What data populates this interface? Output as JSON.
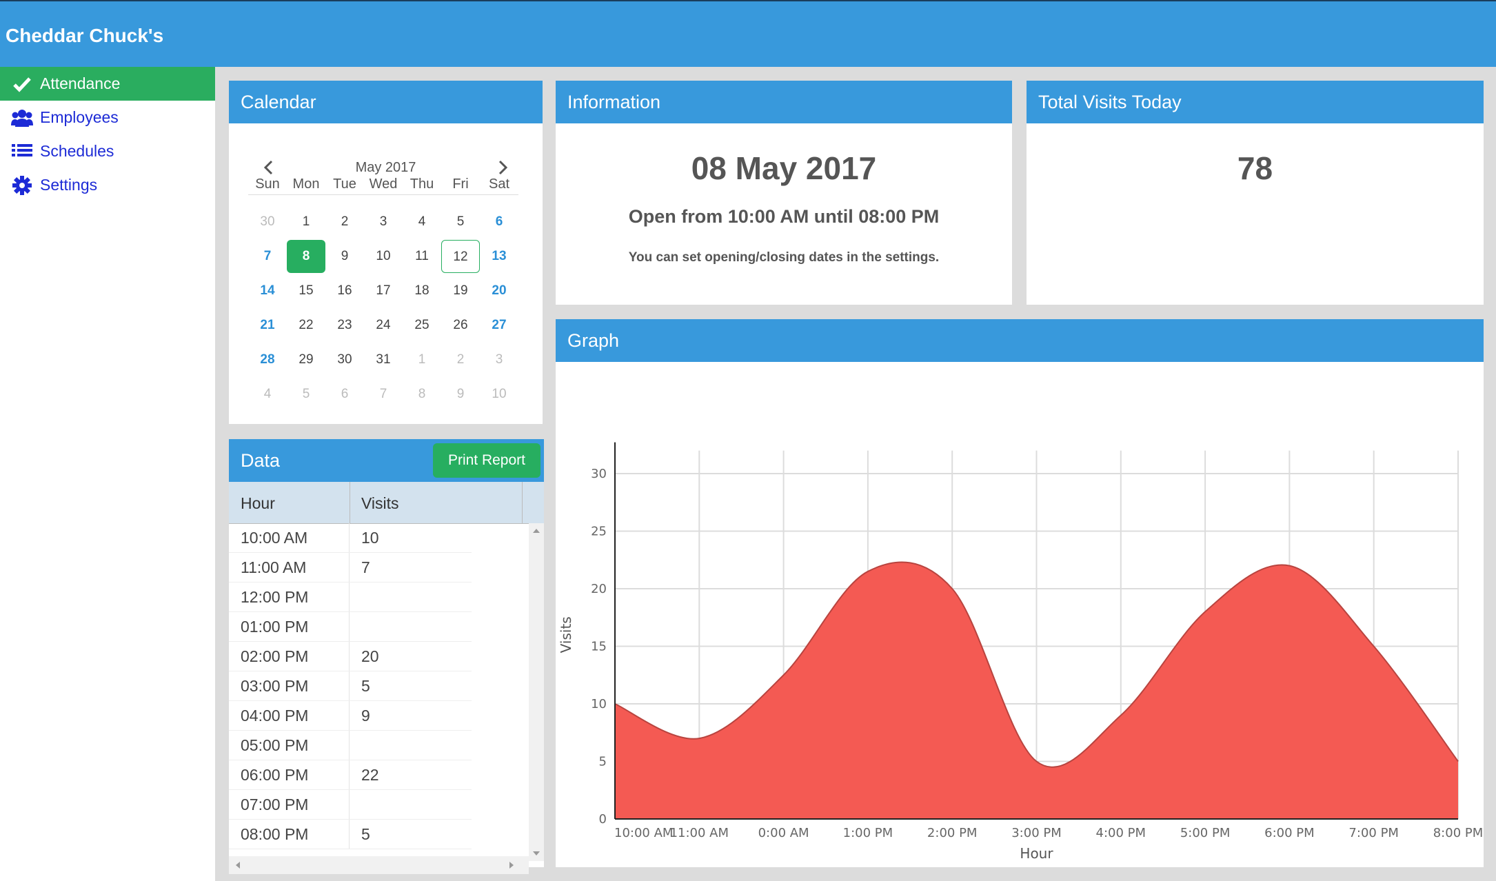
{
  "app": {
    "title": "Cheddar Chuck's"
  },
  "sidebar": {
    "items": [
      {
        "label": "Attendance",
        "icon": "check-icon",
        "active": true
      },
      {
        "label": "Employees",
        "icon": "users-icon",
        "active": false
      },
      {
        "label": "Schedules",
        "icon": "list-icon",
        "active": false
      },
      {
        "label": "Settings",
        "icon": "gear-icon",
        "active": false
      }
    ]
  },
  "calendar": {
    "header": "Calendar",
    "month_label": "May 2017",
    "weekdays": [
      "Sun",
      "Mon",
      "Tue",
      "Wed",
      "Thu",
      "Fri",
      "Sat"
    ],
    "weeks": [
      [
        "30",
        "1",
        "2",
        "3",
        "4",
        "5",
        "6"
      ],
      [
        "7",
        "8",
        "9",
        "10",
        "11",
        "12",
        "13"
      ],
      [
        "14",
        "15",
        "16",
        "17",
        "18",
        "19",
        "20"
      ],
      [
        "21",
        "22",
        "23",
        "24",
        "25",
        "26",
        "27"
      ],
      [
        "28",
        "29",
        "30",
        "31",
        "1",
        "2",
        "3"
      ],
      [
        "4",
        "5",
        "6",
        "7",
        "8",
        "9",
        "10"
      ]
    ],
    "selected_day": "8",
    "today_day": "12"
  },
  "data_panel": {
    "header": "Data",
    "print_button": "Print Report",
    "columns": [
      "Hour",
      "Visits"
    ],
    "rows": [
      [
        "10:00 AM",
        "10"
      ],
      [
        "11:00 AM",
        "7"
      ],
      [
        "12:00 PM",
        ""
      ],
      [
        "01:00 PM",
        ""
      ],
      [
        "02:00 PM",
        "20"
      ],
      [
        "03:00 PM",
        "5"
      ],
      [
        "04:00 PM",
        "9"
      ],
      [
        "05:00 PM",
        ""
      ],
      [
        "06:00 PM",
        "22"
      ],
      [
        "07:00 PM",
        ""
      ],
      [
        "08:00 PM",
        "5"
      ]
    ]
  },
  "information": {
    "header": "Information",
    "date": "08 May 2017",
    "hours": "Open from 10:00 AM until 08:00 PM",
    "note": "You can set opening/closing dates in the settings."
  },
  "total_visits": {
    "header": "Total Visits Today",
    "value": "78"
  },
  "graph": {
    "header": "Graph"
  },
  "chart_data": {
    "type": "area",
    "x": [
      "10:00 AM",
      "11:00 AM",
      "0:00 AM",
      "1:00 PM",
      "2:00 PM",
      "3:00 PM",
      "4:00 PM",
      "5:00 PM",
      "6:00 PM",
      "7:00 PM",
      "8:00 PM"
    ],
    "series": [
      {
        "values": [
          10,
          7,
          12.5,
          21.5,
          20,
          5,
          9,
          18,
          22,
          15,
          5
        ]
      }
    ],
    "xlabel": "Hour",
    "ylabel": "Visits",
    "yticks": [
      0,
      5,
      10,
      15,
      20,
      25,
      30
    ],
    "ylim": [
      0,
      32
    ],
    "grid": true,
    "fill_color": "#f45a53",
    "line_color": "#b8443f"
  }
}
